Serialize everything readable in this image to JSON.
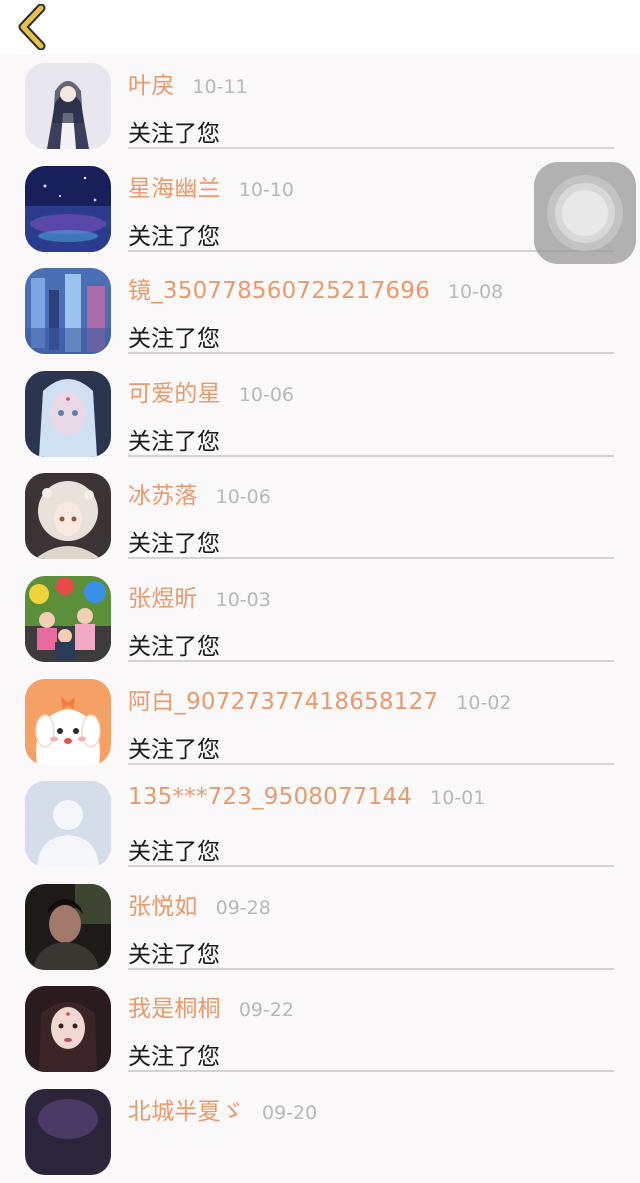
{
  "header": {
    "back_icon": "chevron-left-icon",
    "back_icon_color": "#d8b43a"
  },
  "colors": {
    "username": "#e89a6c",
    "date": "#b8b8b8",
    "action_text": "#1a1a1a",
    "divider": "#d3d3d3",
    "background": "#faf8f9"
  },
  "followers": [
    {
      "name": "叶戾",
      "date": "10-11",
      "action": "关注了您"
    },
    {
      "name": "星海幽兰",
      "date": "10-10",
      "action": "关注了您"
    },
    {
      "name": "镜_350778560725217696",
      "date": "10-08",
      "action": "关注了您"
    },
    {
      "name": "可爱的星",
      "date": "10-06",
      "action": "关注了您"
    },
    {
      "name": "冰苏落",
      "date": "10-06",
      "action": "关注了您"
    },
    {
      "name": "张煜昕",
      "date": "10-03",
      "action": "关注了您"
    },
    {
      "name": "阿白_90727377418658127",
      "date": "10-02",
      "action": "关注了您"
    },
    {
      "name": "135***723_9508077144",
      "date": "10-01",
      "action": "关注了您"
    },
    {
      "name": "张悦如",
      "date": "09-28",
      "action": "关注了您"
    },
    {
      "name": "我是桐桐",
      "date": "09-22",
      "action": "关注了您"
    },
    {
      "name": "北城半夏ゞ",
      "date": "09-20",
      "action": ""
    }
  ],
  "assistive_touch": {
    "icon": "assistive-touch-icon"
  }
}
